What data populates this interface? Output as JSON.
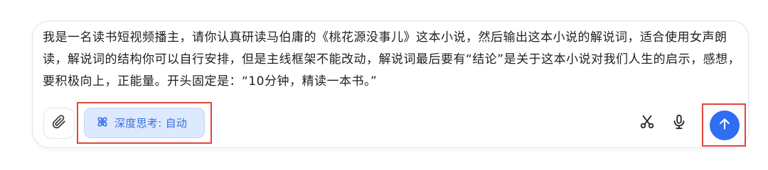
{
  "composer": {
    "prompt_text": "我是一名读书短视频播主，请你认真研读马伯庸的《桃花源没事儿》这本小说，然后输出这本小说的解说词，适合使用女声朗读，解说词的结构你可以自行安排，但是主线框架不能改动，解说词最后要有“结论”是关于这本小说对我们人生的启示，感想，要积极向上，正能量。开头固定是：“10分钟，精读一本书。”"
  },
  "toolbar": {
    "attach_icon": "paperclip-icon",
    "deep_think_label": "深度思考: 自动",
    "deep_think_icon": "atom-icon",
    "scissors_icon": "scissors-icon",
    "mic_icon": "microphone-icon",
    "send_icon": "arrow-up-icon"
  },
  "colors": {
    "accent": "#2f6ef2",
    "highlight_border": "#e0463a",
    "chip_bg": "#dde9fd"
  }
}
